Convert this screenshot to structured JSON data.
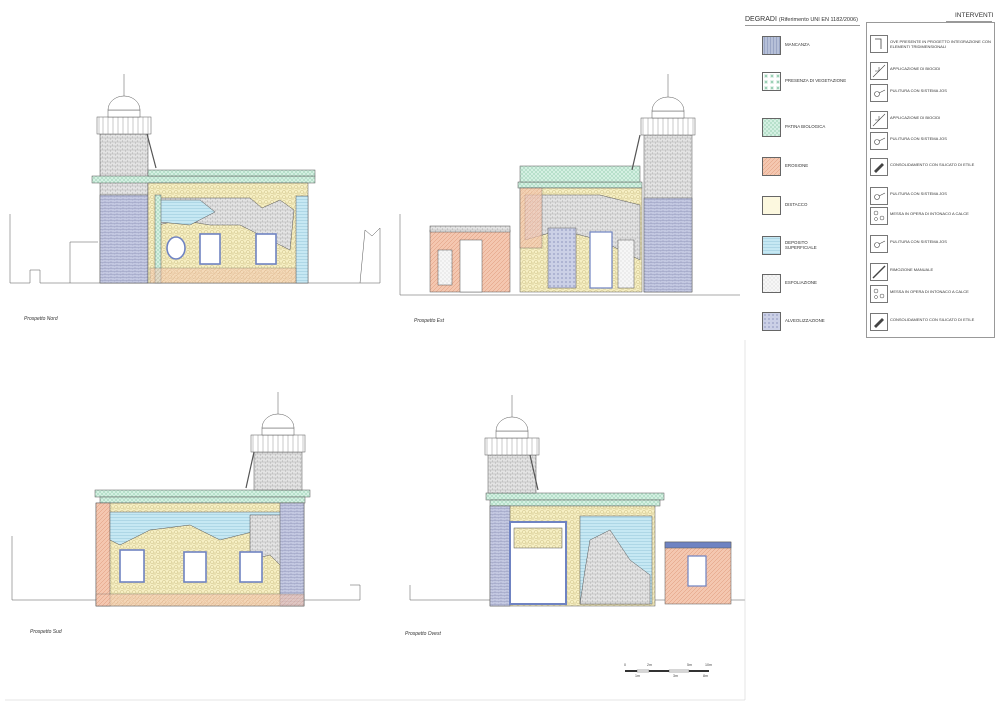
{
  "elevations": [
    {
      "id": "nord",
      "label": "Prospetto Nord"
    },
    {
      "id": "est",
      "label": "Prospetto Est"
    },
    {
      "id": "sud",
      "label": "Prospetto Sud"
    },
    {
      "id": "ovest",
      "label": "Prospetto Ovest"
    }
  ],
  "legend": {
    "degradi_title": "DEGRADI",
    "degradi_ref": "(Riferimento UNI EN 1182/2006)",
    "degradi": [
      {
        "label": "MANCANZA",
        "color": "#b8c2d8"
      },
      {
        "label": "PRESENZA DI VEGETAZIONE",
        "color": "#ffffff"
      },
      {
        "label": "PATINA BIOLOGICA",
        "color": "#cfeee0"
      },
      {
        "label": "EROSIONE",
        "color": "#f3c9b6"
      },
      {
        "label": "DISTACCO",
        "color": "#fbf6d8"
      },
      {
        "label": "DEPOSITO SUPERFICIALE",
        "color": "#bfe6f0"
      },
      {
        "label": "ESFOLIAZIONE",
        "color": "#f1f1f1"
      },
      {
        "label": "ALVEOLIZZAZIONE",
        "color": "#c7cbe3"
      }
    ],
    "interventi_title": "INTERVENTI",
    "interventi": [
      {
        "label": "OVE PRESENTE IN PROGETTO INTEGRAZIONE CON ELEMENTI TRIDIMENSIONALI",
        "icon": "bracket-icon"
      },
      {
        "label": "APPLICAZIONE DI BIOCIDI",
        "icon": "spray-icon"
      },
      {
        "label": "PULITURA CON SISTEMA JOS",
        "icon": "jos-icon"
      },
      {
        "label": "APPLICAZIONE DI BIOCIDI",
        "icon": "spray-icon"
      },
      {
        "label": "PULITURA CON SISTEMA JOS",
        "icon": "jos-icon"
      },
      {
        "label": "CONSOLIDAMENTO CON SILICATO DI ETILE",
        "icon": "brush-icon"
      },
      {
        "label": "PULITURA CON SISTEMA JOS",
        "icon": "jos-icon"
      },
      {
        "label": "MESSA IN OPERA DI INTONACO A CALCE",
        "icon": "plaster-icon"
      },
      {
        "label": "PULITURA CON SISTEMA JOS",
        "icon": "jos-icon"
      },
      {
        "label": "RIMOZIONE MANUALE",
        "icon": "blade-icon"
      },
      {
        "label": "MESSA IN OPERA DI INTONACO A CALCE",
        "icon": "plaster-icon"
      },
      {
        "label": "CONSOLIDAMENTO CON SILICATO DI ETILE",
        "icon": "brush-icon"
      }
    ]
  },
  "scale": {
    "ticks": [
      "0",
      "2m",
      "5m",
      "10m"
    ],
    "sub": [
      "1m",
      "3m",
      "8m"
    ]
  },
  "colors": {
    "stone": "#d9d9d9",
    "brick": "#b9bfd9",
    "cornice": "#bfe6cc",
    "plaster": "#f6efc3",
    "erosion": "#efb89d",
    "deposit": "#bfe5f1",
    "frame": "#6f83c2",
    "line": "#555555"
  }
}
